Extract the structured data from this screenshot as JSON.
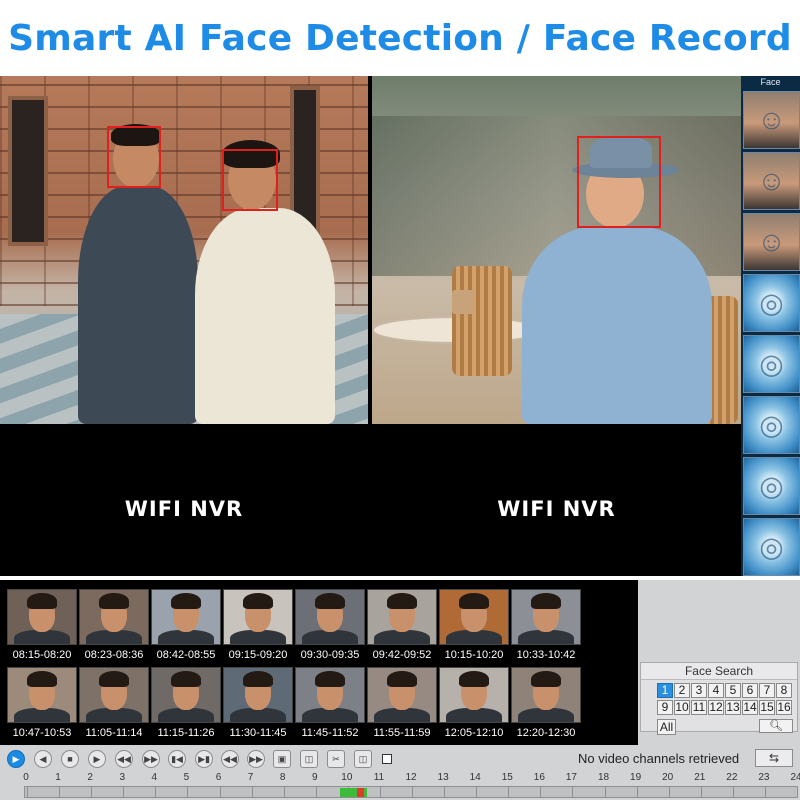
{
  "header": {
    "title": "Smart AI Face Detection / Face Record"
  },
  "feeds": {
    "left_label": "WIFI NVR",
    "right_label": "WIFI NVR",
    "face_panel_title": "Face"
  },
  "detections": {
    "color": "#e0201c"
  },
  "face_sidebar": {
    "items": [
      {
        "type": "photo",
        "icon": "face-photo"
      },
      {
        "type": "photo",
        "icon": "face-photo"
      },
      {
        "type": "photo",
        "icon": "face-photo"
      },
      {
        "type": "scan",
        "icon": "face-scan"
      },
      {
        "type": "scan",
        "icon": "face-scan"
      },
      {
        "type": "scan",
        "icon": "face-scan"
      },
      {
        "type": "scan",
        "icon": "face-scan"
      },
      {
        "type": "scan",
        "icon": "face-scan"
      }
    ]
  },
  "face_records": [
    {
      "time": "08:15-08:20"
    },
    {
      "time": "08:23-08:36"
    },
    {
      "time": "08:42-08:55"
    },
    {
      "time": "09:15-09:20"
    },
    {
      "time": "09:30-09:35"
    },
    {
      "time": "09:42-09:52"
    },
    {
      "time": "10:15-10:20"
    },
    {
      "time": "10:33-10:42"
    },
    {
      "time": "10:47-10:53"
    },
    {
      "time": "11:05-11:14"
    },
    {
      "time": "11:15-11:26"
    },
    {
      "time": "11:30-11:45"
    },
    {
      "time": "11:45-11:52"
    },
    {
      "time": "11:55-11:59"
    },
    {
      "time": "12:05-12:10"
    },
    {
      "time": "12:20-12:30"
    }
  ],
  "face_search": {
    "title": "Face Search",
    "channels": [
      "1",
      "2",
      "3",
      "4",
      "5",
      "6",
      "7",
      "8",
      "9",
      "10",
      "11",
      "12",
      "13",
      "14",
      "15",
      "16"
    ],
    "selected_channel": "1",
    "all_label": "All",
    "search_icon": "search-icon"
  },
  "controls": {
    "status": "No video channels retrieved",
    "accent": "#1d8ae3"
  },
  "timeline": {
    "hours": [
      "0",
      "1",
      "2",
      "3",
      "4",
      "5",
      "6",
      "7",
      "8",
      "9",
      "10",
      "11",
      "12",
      "13",
      "14",
      "15",
      "16",
      "17",
      "18",
      "19",
      "20",
      "21",
      "22",
      "23",
      "24"
    ],
    "recorded_colors": [
      "#3dbb3a",
      "#e03a2a"
    ]
  }
}
